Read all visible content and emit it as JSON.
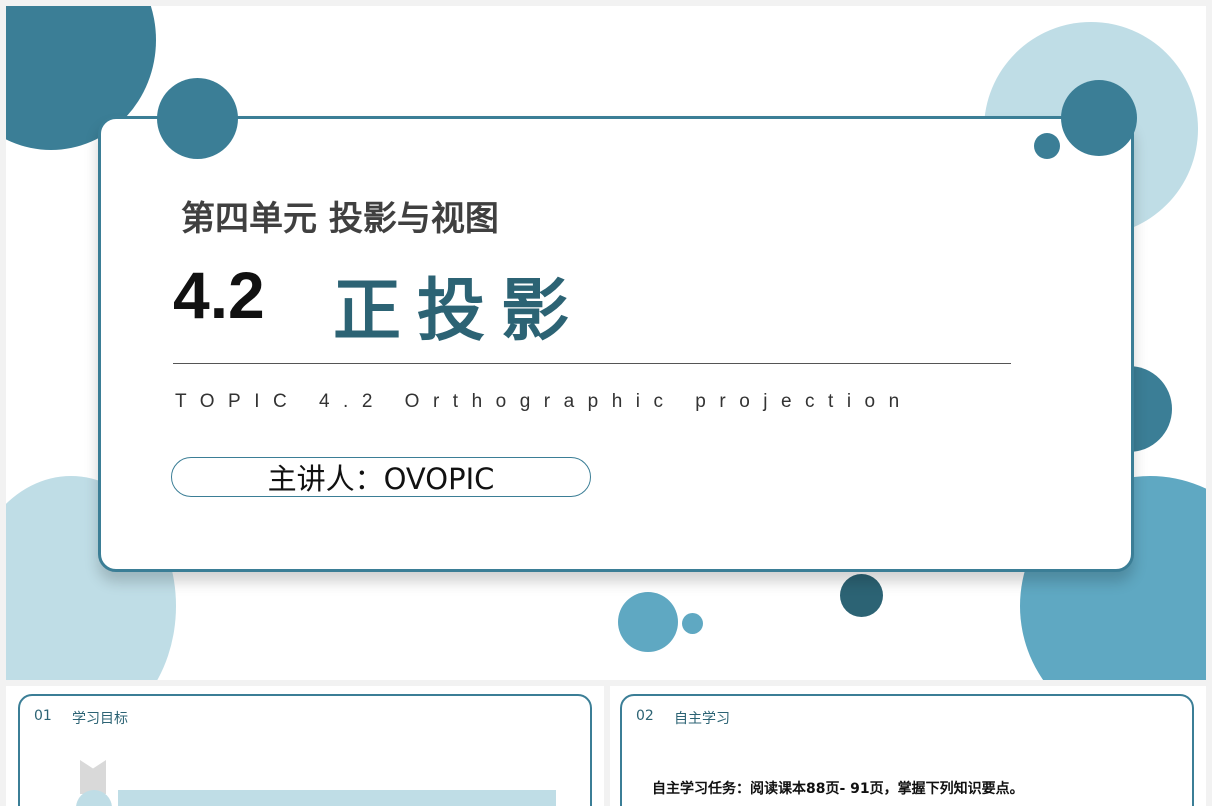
{
  "slide": {
    "unit_title": "第四单元 投影与视图",
    "lesson_number": "4.2",
    "lesson_name": "正投影",
    "topic_en": "TOPIC 4.2 Orthographic projection",
    "presenter": "主讲人：OVOPIC"
  },
  "thumbnails": [
    {
      "number": "01",
      "title": "学习目标"
    },
    {
      "number": "02",
      "title": "自主学习",
      "task_text": "自主学习任务：阅读课本88页- 91页，掌握下列知识要点。"
    }
  ],
  "colors": {
    "dark_teal": "#3b7e96",
    "deep_teal": "#2c6374",
    "mid_blue": "#5fa8c2",
    "light_blue": "#bfdde6",
    "text_dark": "#404040"
  }
}
